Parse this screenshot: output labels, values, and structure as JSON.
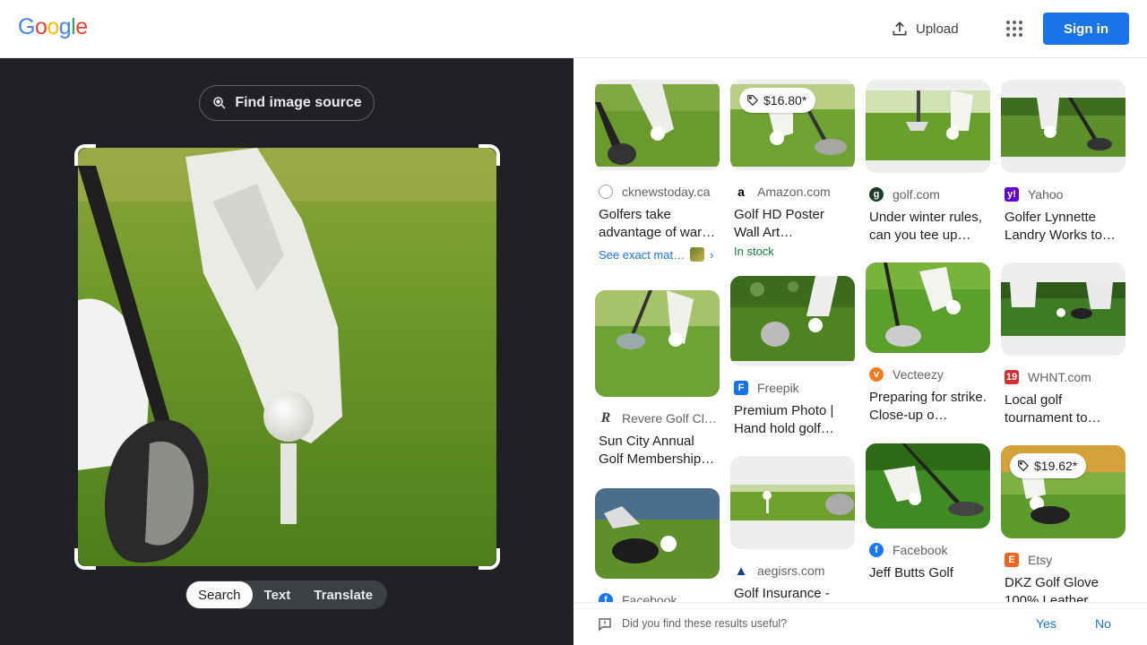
{
  "header": {
    "logo_letters": [
      {
        "char": "G",
        "color": "#4285f4"
      },
      {
        "char": "o",
        "color": "#ea4335"
      },
      {
        "char": "o",
        "color": "#fbbc05"
      },
      {
        "char": "g",
        "color": "#4285f4"
      },
      {
        "char": "l",
        "color": "#34a853"
      },
      {
        "char": "e",
        "color": "#ea4335"
      }
    ],
    "upload_label": "Upload",
    "apps_icon": "apps-grid-icon",
    "signin_label": "Sign in"
  },
  "lens": {
    "find_source_label": "Find image source",
    "tabs": [
      {
        "label": "Search",
        "active": true
      },
      {
        "label": "Text",
        "active": false
      },
      {
        "label": "Translate",
        "active": false
      }
    ]
  },
  "results": [
    {
      "source": "cknewstoday.ca",
      "fav_icon": "spiral-icon",
      "title": "Golfers take advantage of war…",
      "exact": "See exact mat…"
    },
    {
      "source": "Amazon.com",
      "fav_icon": "amazon-icon",
      "title": "Golf HD Poster Wall Art Paintings…",
      "price": "$16.80*",
      "stock": "In stock"
    },
    {
      "source": "golf.com",
      "fav_icon": "golf-com-icon",
      "title": "Under winter rules, can you tee up…"
    },
    {
      "source": "Yahoo",
      "fav_icon": "yahoo-icon",
      "title": "Golfer Lynnette Landry Works to…"
    },
    {
      "source": "Revere Golf Cl…",
      "fav_icon": "revere-icon",
      "title": "Sun City Annual Golf Membership…"
    },
    {
      "source": "Freepik",
      "fav_icon": "freepik-icon",
      "title": "Premium Photo | Hand hold golf ba…"
    },
    {
      "source": "Vecteezy",
      "fav_icon": "vecteezy-icon",
      "title": "Preparing for strike. Close-up o…"
    },
    {
      "source": "WHNT.com",
      "fav_icon": "whnt-icon",
      "title": "Local golf tournament to…"
    },
    {
      "source": "Facebook",
      "fav_icon": "facebook-icon",
      "title": ""
    },
    {
      "source": "aegisrs.com",
      "fav_icon": "aegis-icon",
      "title": "Golf Insurance -"
    },
    {
      "source": "Facebook",
      "fav_icon": "facebook-icon",
      "title": "Jeff Butts Golf"
    },
    {
      "source": "Etsy",
      "fav_icon": "etsy-icon",
      "title": "DKZ Golf Glove 100% Leather…",
      "price": "$19.62*"
    }
  ],
  "feedback": {
    "question": "Did you find these results useful?",
    "yes_label": "Yes",
    "no_label": "No"
  },
  "colors": {
    "accent": "#1a73e8",
    "dark_panel": "#202124",
    "stock_green": "#188038"
  }
}
